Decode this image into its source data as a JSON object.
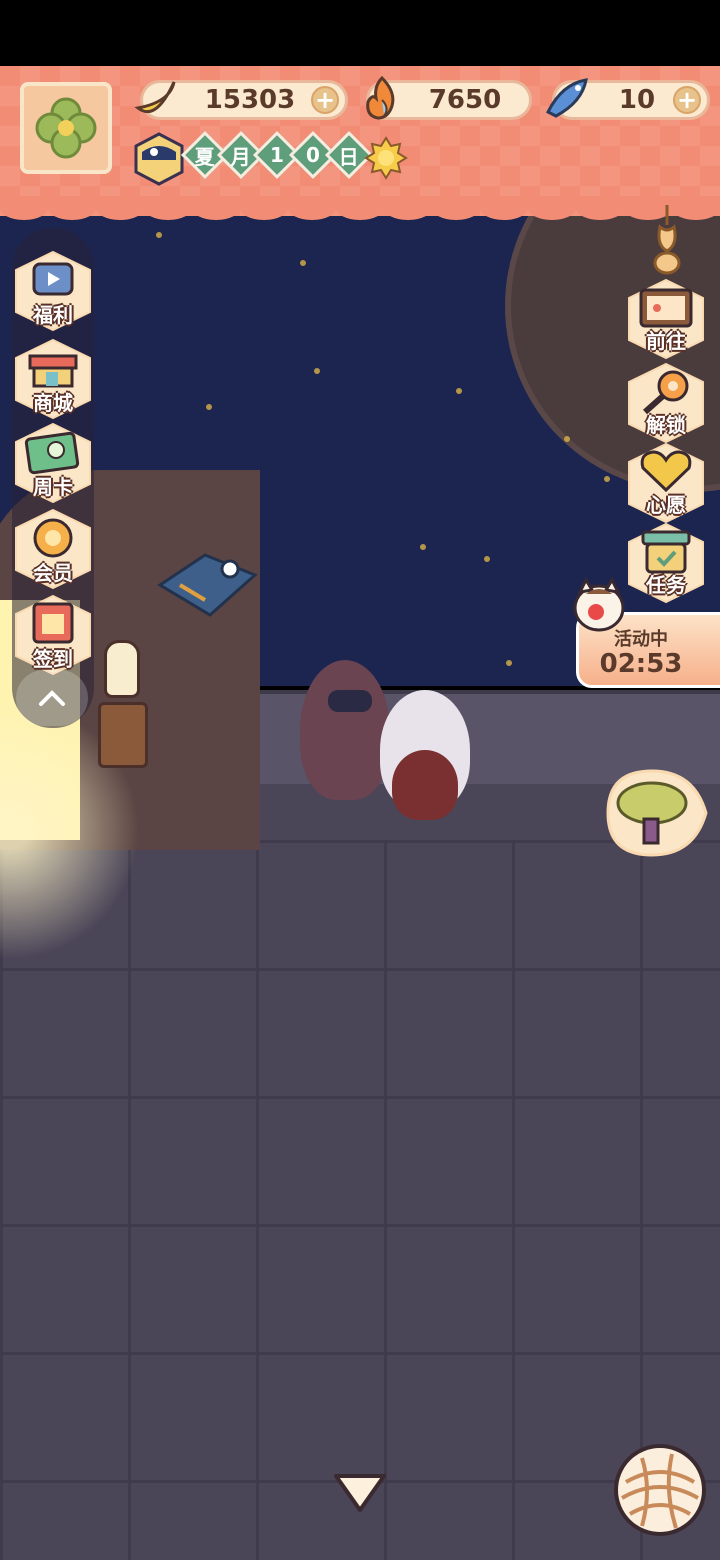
{
  "hud": {
    "resources": [
      {
        "name": "banana",
        "value": "15303",
        "has_plus": true,
        "icon": "banana-icon"
      },
      {
        "name": "flame",
        "value": "7650",
        "has_plus": false,
        "icon": "flame-icon"
      },
      {
        "name": "fish",
        "value": "10",
        "has_plus": true,
        "icon": "fish-icon"
      }
    ],
    "date_chars": [
      "夏",
      "月",
      "1",
      "0",
      "日"
    ]
  },
  "left_menu": [
    {
      "label": "福利",
      "icon": "tv-icon"
    },
    {
      "label": "商城",
      "icon": "shop-icon"
    },
    {
      "label": "周卡",
      "icon": "weekly-card-icon"
    },
    {
      "label": "会员",
      "icon": "flower-icon"
    },
    {
      "label": "签到",
      "icon": "calendar-icon"
    }
  ],
  "right_menu": [
    {
      "label": "前往",
      "icon": "map-board-icon"
    },
    {
      "label": "解锁",
      "icon": "key-icon"
    },
    {
      "label": "心愿",
      "icon": "heart-book-icon"
    },
    {
      "label": "任务",
      "icon": "task-jar-icon"
    }
  ],
  "event": {
    "title": "活动中",
    "timer": "02:53"
  },
  "colors": {
    "hud": "#f38c74",
    "sky": "#1c2550",
    "ground": "#4b4558",
    "accent_green": "#5f9e7a"
  }
}
